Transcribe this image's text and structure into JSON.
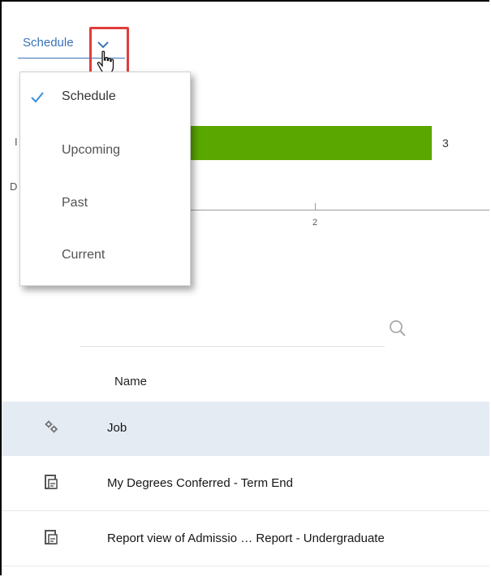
{
  "header": {
    "view_selector_label": "Schedule"
  },
  "dropdown": {
    "items": [
      {
        "label": "Schedule",
        "selected": true
      },
      {
        "label": "Upcoming",
        "selected": false
      },
      {
        "label": "Past",
        "selected": false
      },
      {
        "label": "Current",
        "selected": false
      }
    ]
  },
  "chart_data": {
    "type": "bar",
    "orientation": "horizontal",
    "bar_value_label": "3",
    "values": [
      3
    ],
    "x_tick_labels": [
      "2"
    ],
    "partial_category_labels": [
      "I",
      "D"
    ],
    "bar_color": "#5aa700"
  },
  "search": {
    "value": "",
    "placeholder": ""
  },
  "list": {
    "column_header": "Name",
    "rows": [
      {
        "name": "Job",
        "icon": "gears-icon",
        "selected": true
      },
      {
        "name": "My Degrees Conferred - Term End",
        "icon": "report-icon",
        "selected": false
      },
      {
        "name": "Report view of Admissio … Report - Undergraduate",
        "icon": "report-icon",
        "selected": false
      }
    ]
  },
  "colors": {
    "accent": "#3b73b9",
    "highlight": "#e03c3c",
    "selected_row": "#e5ebf3",
    "check": "#3b8fdc"
  }
}
